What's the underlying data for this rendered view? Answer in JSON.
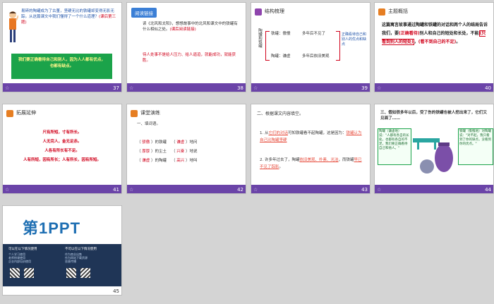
{
  "slides": [
    {
      "num": "37",
      "text": "易碎的陶罐成为了古董，坚硬无比的铁罐却变得无影无踪。从这篇课文中我们懂得了一个什么道理？",
      "text_hint": "(课后第三题)",
      "box": "我们要正确看待自己和别人，因为人人都有优点，也都有缺点。"
    },
    {
      "num": "38",
      "tag": "阅读链接",
      "line1": "读《北风和太阳》，想想故事中的北风和课文中的铁罐有什么相似之处。",
      "hint": "(课后阅读链接)",
      "answer": "待人处事不是给人压力、给人逼迫，就能成功，就能获胜。"
    },
    {
      "num": "39",
      "tag": "结构梳理",
      "vertical": "陶罐和铁罐",
      "row1_left": "铁罐：傲慢",
      "row1_right": "多年后不见了",
      "row2_left": "陶罐：谦虚",
      "row2_right": "多年后依旧美观",
      "side": "正确看待自己和别人的优点和缺点"
    },
    {
      "num": "40",
      "tag": "主题概括",
      "p1": "这篇寓言故事通过陶罐和铁罐的对话和两个人的结局告诉我们，要",
      "b1": "(正确看待)",
      "p2": "别人和自己的短处和长处，不能",
      "b2": "(只看到别人的短处)",
      "p3": "，",
      "b3": "(看不到自己的不足)",
      "p4": "。"
    },
    {
      "num": "41",
      "tag": "拓展延伸",
      "lines": [
        "尺有所短，寸有所长。",
        "人无完人，金无足赤。",
        "人各有所长有不足。",
        "人有所短，因有所长；人有所长，因有所短。"
      ]
    },
    {
      "num": "42",
      "tag": "课堂演练",
      "instruction": "一、填词语。",
      "rows": [
        {
          "a": "骄傲",
          "a_suffix": "的铁罐",
          "b": "谦虚",
          "b_suffix": "地问"
        },
        {
          "a": "厚厚",
          "a_suffix": "的尘土",
          "b": "兴奋",
          "b_suffix": "地说"
        },
        {
          "a": "谦虚",
          "a_suffix": "的陶罐",
          "b": "高兴",
          "b_suffix": "地叫"
        }
      ]
    },
    {
      "num": "43",
      "heading": "二、根据课文内容填空。",
      "q1a": "1. 从",
      "q1ans": "它们的对话",
      "q1b": "可知铁罐看不起陶罐，这是因为：",
      "q1ans2": "铁罐认为自己比陶罐坚硬",
      "q2a": "2. 许多年过去了，陶罐",
      "q2ans": "依旧美观、朴素、光洁",
      "q2b": "，而铁罐",
      "q2ans2": "早已不见了踪影",
      "q2c": "。"
    },
    {
      "num": "44",
      "heading": "三、假如很多年以后，受了伤的铁罐也被人挖出来了，它们又见面了……",
      "left_label": "陶罐（谦虚地）说：",
      "left_text": "\"人都有各自的长处，也都有各自的不足，我们要正确看待自己和他人。\"",
      "right_label": "铁罐（惭愧地）对陶罐说：",
      "right_text": "\"对不起，我只看到了你的缺点，没看到你的优点。\""
    },
    {
      "num": "45",
      "logo": "第1PPT",
      "left_title": "可以在以下情况使用",
      "right_title": "不可以在以下情况使用",
      "left_items": [
        "个人学习使用",
        "老师授课使用",
        "企业内部培训使用"
      ],
      "right_items": [
        "作为商业出售",
        "作为网站下载资源",
        "恶意传播"
      ]
    }
  ],
  "colors": {
    "footer": "#6b44a8",
    "green": "#1ba34a",
    "answer": "#e74c3c"
  }
}
